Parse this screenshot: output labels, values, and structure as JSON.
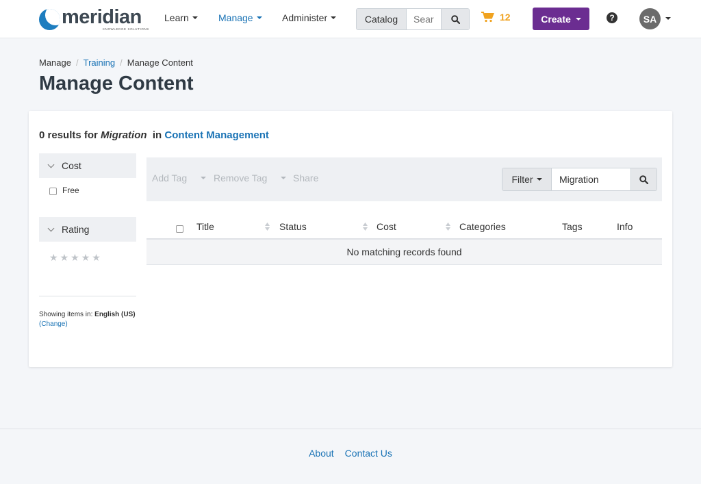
{
  "brand": {
    "name": "meridian",
    "tagline": "KNOWLEDGE SOLUTIONS"
  },
  "nav": {
    "menus": [
      {
        "label": "Learn"
      },
      {
        "label": "Manage"
      },
      {
        "label": "Administer"
      }
    ],
    "search": {
      "scope_label": "Catalog",
      "placeholder": "Search"
    },
    "cart_count": "12",
    "create_label": "Create",
    "user_initials": "SA"
  },
  "breadcrumb": [
    "Manage",
    "Training",
    "Manage Content"
  ],
  "page_title": "Manage Content",
  "results": {
    "prefix": "0 results for",
    "term": "Migration",
    "in_word": "in",
    "scope": "Content Management"
  },
  "facets": {
    "cost": {
      "label": "Cost",
      "options": [
        "Free"
      ]
    },
    "rating": {
      "label": "Rating",
      "stars": 5
    },
    "language_note": {
      "prefix": "Showing items in:",
      "language": "English (US)",
      "change_label": "Change"
    }
  },
  "toolbar": {
    "add_tag": "Add Tag",
    "remove_tag": "Remove Tag",
    "share": "Share",
    "filter_label": "Filter",
    "filter_value": "Migration"
  },
  "table": {
    "columns": [
      "Title",
      "Status",
      "Cost",
      "Categories",
      "Tags",
      "Info"
    ],
    "empty_message": "No matching records found"
  },
  "footer": {
    "links": [
      "About",
      "Contact Us"
    ]
  },
  "colors": {
    "accent": "#1a73b5",
    "create": "#6b2d91",
    "cart": "#f0a21f"
  }
}
